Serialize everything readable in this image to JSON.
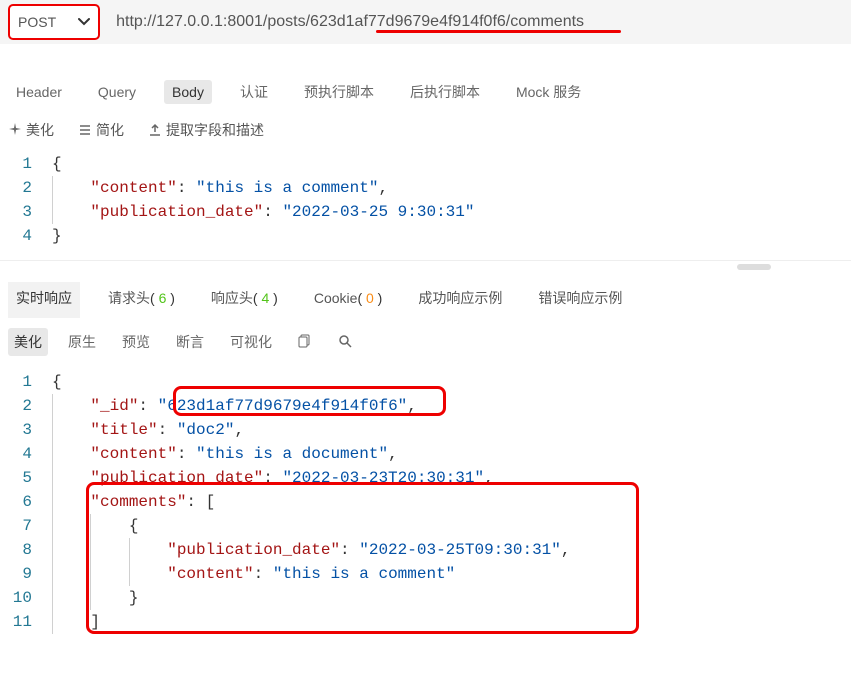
{
  "request": {
    "method": "POST",
    "url_prefix": "http://127.0.0.1:8001/posts/",
    "url_id": "623d1af77d9679e4f914f0f6",
    "url_suffix": "/comments"
  },
  "req_tabs": {
    "header": "Header",
    "query": "Query",
    "body": "Body",
    "auth": "认证",
    "pre_script": "预执行脚本",
    "post_script": "后执行脚本",
    "mock": "Mock 服务"
  },
  "tools": {
    "beautify": "美化",
    "simplify": "简化",
    "extract": "提取字段和描述"
  },
  "req_body": {
    "lines": [
      "1",
      "2",
      "3",
      "4"
    ],
    "l1": "{",
    "l2_key": "\"content\"",
    "l2_val": "\"this is a comment\"",
    "l3_key": "\"publication_date\"",
    "l3_val": "\"2022-03-25 9:30:31\"",
    "l4": "}"
  },
  "resp_tabs": {
    "realtime": "实时响应",
    "req_headers": "请求头",
    "req_headers_count": "6",
    "resp_headers": "响应头",
    "resp_headers_count": "4",
    "cookie": "Cookie",
    "cookie_count": "0",
    "success_ex": "成功响应示例",
    "error_ex": "错误响应示例"
  },
  "resp_subtabs": {
    "beautify": "美化",
    "raw": "原生",
    "preview": "预览",
    "assertion": "断言",
    "visualize": "可视化"
  },
  "response_body": {
    "lines": [
      "1",
      "2",
      "3",
      "4",
      "5",
      "6",
      "7",
      "8",
      "9",
      "10",
      "11"
    ],
    "l1": "{",
    "l2_key": "\"_id\"",
    "l2_val": "\"623d1af77d9679e4f914f0f6\"",
    "l3_key": "\"title\"",
    "l3_val": "\"doc2\"",
    "l4_key": "\"content\"",
    "l4_val": "\"this is a document\"",
    "l5_key": "\"publication_date\"",
    "l5_val": "\"2022-03-23T20:30:31\"",
    "l6_key": "\"comments\"",
    "l8_key": "\"publication_date\"",
    "l8_val": "\"2022-03-25T09:30:31\"",
    "l9_key": "\"content\"",
    "l9_val": "\"this is a comment\""
  }
}
